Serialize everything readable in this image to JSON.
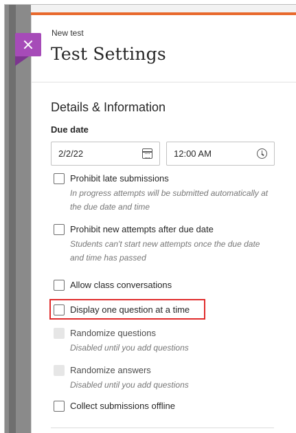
{
  "panel": {
    "subtitle": "New test",
    "title": "Test Settings",
    "accent_color": "#e8692c",
    "close_tab_color": "#a64bb8"
  },
  "details": {
    "heading": "Details & Information",
    "due_date_label": "Due date",
    "date_value": "2/2/22",
    "time_value": "12:00 AM"
  },
  "options": [
    {
      "label": "Prohibit late submissions",
      "help": "In progress attempts will be submitted automatically at the due date and time",
      "checked": false,
      "disabled": false
    },
    {
      "label": "Prohibit new attempts after due date",
      "help": "Students can't start new attempts once the due date and time has passed",
      "checked": false,
      "disabled": false
    },
    {
      "label": "Allow class conversations",
      "help": "",
      "checked": false,
      "disabled": false
    },
    {
      "label": "Display one question at a time",
      "help": "",
      "checked": false,
      "disabled": false,
      "highlighted": true,
      "highlight_color": "#e02a2a"
    },
    {
      "label": "Randomize questions",
      "help": "Disabled until you add questions",
      "checked": false,
      "disabled": true
    },
    {
      "label": "Randomize answers",
      "help": "Disabled until you add questions",
      "checked": false,
      "disabled": true
    },
    {
      "label": "Collect submissions offline",
      "help": "",
      "checked": false,
      "disabled": false
    }
  ],
  "icons": {
    "close": "close-icon",
    "calendar": "calendar-icon",
    "clock": "clock-icon"
  }
}
